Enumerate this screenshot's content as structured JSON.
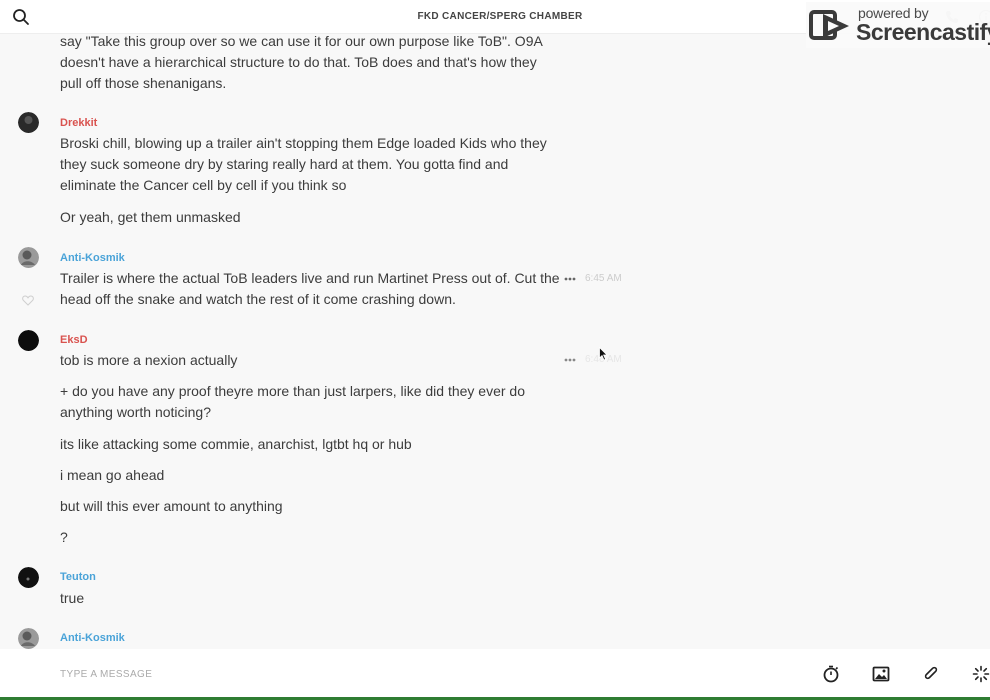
{
  "header": {
    "room_title": "FKD CANCER/SPERG CHAMBER",
    "watermark_powered": "powered by",
    "watermark_brand": "Screencastify"
  },
  "messages": [
    {
      "author": "",
      "author_color": "",
      "lines": [
        "say \"Take this group over so we can use it for our own purpose like ToB\". O9A doesn't have a hierarchical structure to do that. ToB does and that's how they pull off those shenanigans."
      ]
    },
    {
      "author": "Drekkit",
      "author_color": "#d9534f",
      "lines": [
        "Broski chill, blowing up a trailer ain't stopping them Edge loaded Kids who they they suck someone dry by staring really hard at them. You gotta find and eliminate the Cancer cell by cell if you think so",
        "Or yeah, get them unmasked"
      ]
    },
    {
      "author": "Anti-Kosmik",
      "author_color": "#4aa3d8",
      "timestamp": "6:45 AM",
      "lines": [
        "Trailer is where the actual ToB leaders live and run Martinet Press out of. Cut the head off the snake and watch the rest of it come crashing down."
      ]
    },
    {
      "author": "EksD",
      "author_color": "#d9534f",
      "timestamp": "6:46 AM",
      "lines": [
        "tob is more a nexion actually",
        "+ do you have any proof theyre more than just larpers, like did they ever do anything worth noticing?",
        "its like attacking some commie, anarchist, lgtbt hq or hub",
        "i mean go ahead",
        "but will this ever amount to anything",
        "?"
      ]
    },
    {
      "author": "Teuton",
      "author_color": "#4aa3d8",
      "lines": [
        "true"
      ]
    },
    {
      "author": "Anti-Kosmik",
      "author_color": "#4aa3d8",
      "lines": []
    }
  ],
  "composer": {
    "placeholder": "TYPE A MESSAGE"
  },
  "icons": [
    "search-icon",
    "phone-icon",
    "info-icon",
    "heart-icon",
    "more-options-icon",
    "timer-icon",
    "image-icon",
    "attachment-icon",
    "loading-icon"
  ]
}
